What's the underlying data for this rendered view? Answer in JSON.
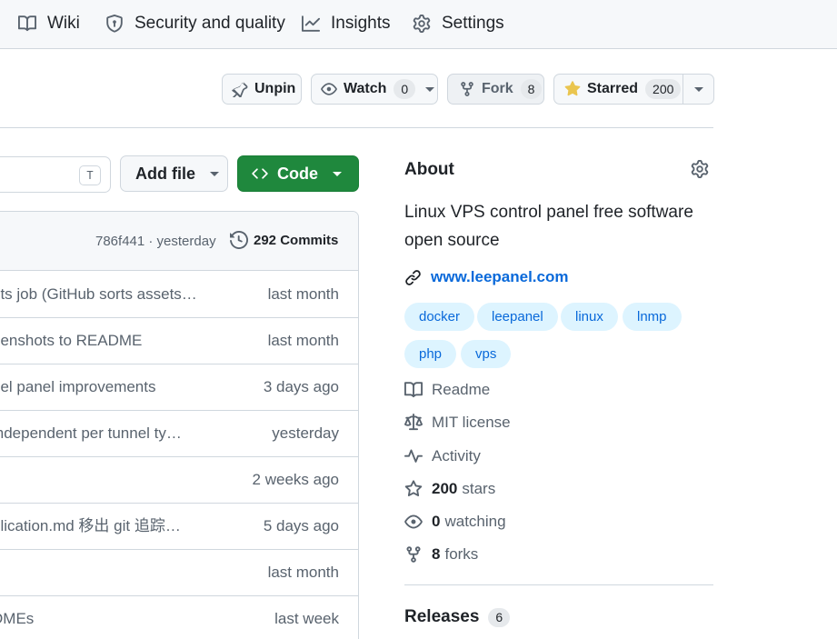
{
  "nav": {
    "wiki": "Wiki",
    "security": "Security and quality",
    "insights": "Insights",
    "settings": "Settings"
  },
  "actions": {
    "unpin": "Unpin",
    "watch": "Watch",
    "watch_count": "0",
    "fork": "Fork",
    "fork_count": "8",
    "starred": "Starred",
    "star_count": "200"
  },
  "toolbar": {
    "search_shortcut": "T",
    "add_file": "Add file",
    "code": "Code"
  },
  "commit_bar": {
    "sha_time": "786f441 · yesterday",
    "commits": "292 Commits"
  },
  "files": [
    {
      "message": "ets job (GitHub sorts assets…",
      "time": "last month"
    },
    {
      "message": "eenshots to README",
      "time": "last month"
    },
    {
      "message": "nel panel improvements",
      "time": "3 days ago"
    },
    {
      "message": " independent per tunnel ty…",
      "time": "yesterday"
    },
    {
      "message": "",
      "time": "2 weeks ago"
    },
    {
      "message": "plication.md 移出 git 追踪…",
      "time": "5 days ago"
    },
    {
      "message": "",
      "time": "last month"
    },
    {
      "message": "DMEs",
      "time": "last week"
    }
  ],
  "about": {
    "title": "About",
    "description": "Linux VPS control panel free software open source",
    "website": "www.leepanel.com",
    "topics": [
      "docker",
      "leepanel",
      "linux",
      "lnmp",
      "php",
      "vps"
    ],
    "readme": "Readme",
    "license": "MIT license",
    "activity": "Activity",
    "stars_count": "200",
    "stars_label": "stars",
    "watching_count": "0",
    "watching_label": "watching",
    "forks_count": "8",
    "forks_label": "forks",
    "releases": "Releases",
    "releases_count": "6"
  },
  "colors": {
    "primary_green": "#1f883d",
    "link_blue": "#0969da",
    "topic_bg": "#ddf4ff",
    "star_yellow": "#eac54f"
  }
}
